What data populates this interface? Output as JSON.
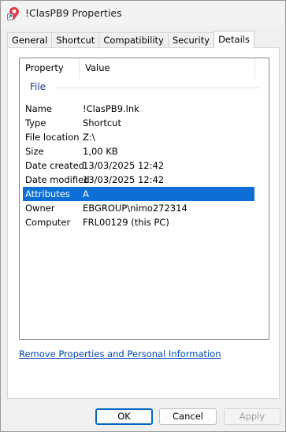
{
  "window": {
    "title": "!ClasPB9 Properties"
  },
  "tabs": [
    {
      "label": "General",
      "active": false
    },
    {
      "label": "Shortcut",
      "active": false
    },
    {
      "label": "Compatibility",
      "active": false
    },
    {
      "label": "Security",
      "active": false
    },
    {
      "label": "Details",
      "active": true
    }
  ],
  "details": {
    "columns": {
      "property": "Property",
      "value": "Value"
    },
    "group": "File",
    "rows": [
      {
        "key": "Name",
        "value": "!ClasPB9.lnk"
      },
      {
        "key": "Type",
        "value": "Shortcut"
      },
      {
        "key": "File location",
        "value": "Z:\\"
      },
      {
        "key": "Size",
        "value": "1,00 KB"
      },
      {
        "key": "Date created",
        "value": "13/03/2025 12:42"
      },
      {
        "key": "Date modified",
        "value": "13/03/2025 12:42"
      },
      {
        "key": "Attributes",
        "value": "A"
      },
      {
        "key": "Owner",
        "value": "EBGROUP\\nimo272314"
      },
      {
        "key": "Computer",
        "value": "FRL00129 (this PC)"
      }
    ],
    "selected_row": "Attributes",
    "remove_link": "Remove Properties and Personal Information"
  },
  "buttons": {
    "ok": "OK",
    "cancel": "Cancel",
    "apply": "Apply"
  },
  "colors": {
    "selection": "#0b6fd6",
    "link": "#0046b6",
    "group_header": "#1e3a8a"
  }
}
